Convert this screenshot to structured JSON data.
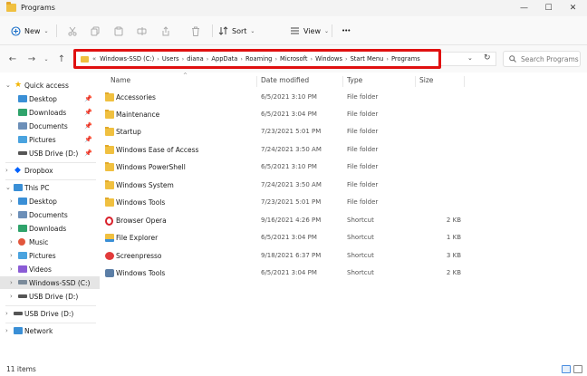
{
  "window": {
    "title": "Programs",
    "controls": {
      "minimize": "—",
      "maximize": "☐",
      "close": "✕"
    }
  },
  "toolbar": {
    "new_label": "New",
    "sort_label": "Sort",
    "view_label": "View",
    "more_label": "•••",
    "icons": [
      "cut-icon",
      "copy-icon",
      "paste-icon",
      "rename-icon",
      "share-icon",
      "delete-icon"
    ]
  },
  "navigation": {
    "back": "←",
    "forward": "→",
    "up": "↑",
    "dropdown": "⌄"
  },
  "address_bar": {
    "overflow": "«",
    "segments": [
      "Windows-SSD (C:)",
      "Users",
      "diana",
      "AppData",
      "Roaming",
      "Microsoft",
      "Windows",
      "Start Menu",
      "Programs"
    ],
    "highlight_color": "#e01010"
  },
  "search": {
    "placeholder": "Search Programs"
  },
  "sidebar": {
    "quick_access": {
      "label": "Quick access",
      "items": [
        {
          "label": "Desktop",
          "icon": "desktop-icon"
        },
        {
          "label": "Downloads",
          "icon": "downloads-icon"
        },
        {
          "label": "Documents",
          "icon": "documents-icon"
        },
        {
          "label": "Pictures",
          "icon": "pictures-icon"
        },
        {
          "label": "USB Drive (D:)",
          "icon": "usb-drive-icon"
        }
      ]
    },
    "dropbox": {
      "label": "Dropbox"
    },
    "this_pc": {
      "label": "This PC",
      "items": [
        {
          "label": "Desktop"
        },
        {
          "label": "Documents"
        },
        {
          "label": "Downloads"
        },
        {
          "label": "Music"
        },
        {
          "label": "Pictures"
        },
        {
          "label": "Videos"
        },
        {
          "label": "Windows-SSD (C:)"
        },
        {
          "label": "USB Drive (D:)"
        }
      ]
    },
    "usb_drive": {
      "label": "USB Drive (D:)"
    },
    "network": {
      "label": "Network"
    }
  },
  "columns": {
    "name": "Name",
    "date": "Date modified",
    "type": "Type",
    "size": "Size"
  },
  "files": [
    {
      "name": "Accessories",
      "date": "6/5/2021 3:10 PM",
      "type": "File folder",
      "size": "",
      "icon": "folder"
    },
    {
      "name": "Maintenance",
      "date": "6/5/2021 3:04 PM",
      "type": "File folder",
      "size": "",
      "icon": "folder"
    },
    {
      "name": "Startup",
      "date": "7/23/2021 5:01 PM",
      "type": "File folder",
      "size": "",
      "icon": "folder"
    },
    {
      "name": "Windows Ease of Access",
      "date": "7/24/2021 3:50 AM",
      "type": "File folder",
      "size": "",
      "icon": "folder"
    },
    {
      "name": "Windows PowerShell",
      "date": "6/5/2021 3:10 PM",
      "type": "File folder",
      "size": "",
      "icon": "folder"
    },
    {
      "name": "Windows System",
      "date": "7/24/2021 3:50 AM",
      "type": "File folder",
      "size": "",
      "icon": "folder"
    },
    {
      "name": "Windows Tools",
      "date": "7/23/2021 5:01 PM",
      "type": "File folder",
      "size": "",
      "icon": "folder"
    },
    {
      "name": "Browser Opera",
      "date": "9/16/2021 4:26 PM",
      "type": "Shortcut",
      "size": "2 KB",
      "icon": "opera"
    },
    {
      "name": "File Explorer",
      "date": "6/5/2021 3:04 PM",
      "type": "Shortcut",
      "size": "1 KB",
      "icon": "explorer"
    },
    {
      "name": "Screenpresso",
      "date": "9/18/2021 6:37 PM",
      "type": "Shortcut",
      "size": "3 KB",
      "icon": "screenpresso"
    },
    {
      "name": "Windows Tools",
      "date": "6/5/2021 3:04 PM",
      "type": "Shortcut",
      "size": "2 KB",
      "icon": "tools"
    }
  ],
  "status": {
    "item_count": "11 items"
  }
}
